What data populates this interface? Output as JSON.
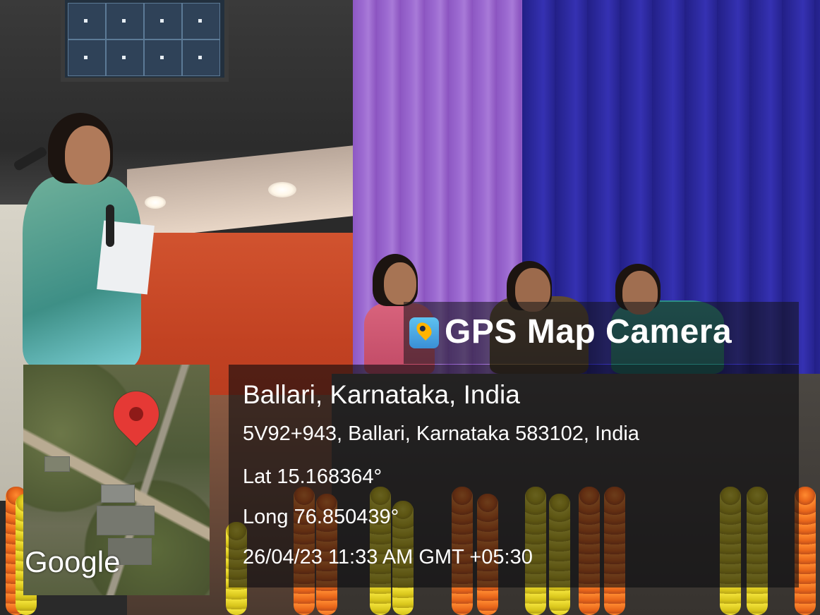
{
  "overlay": {
    "app_title": "GPS Map Camera",
    "place": "Ballari, Karnataka, India",
    "address": "5V92+943, Ballari, Karnataka 583102, India",
    "latitude": "Lat 15.168364°",
    "longitude": "Long 76.850439°",
    "timestamp": "26/04/23 11:33 AM GMT +05:30",
    "map_attribution": "Google",
    "map_pin_icon": "location-pin-icon",
    "app_logo_icon": "gps-map-camera-icon"
  },
  "colors": {
    "pin": "#e53935",
    "overlay_text": "#ffffff",
    "purple_curtain": "#9c6ad1",
    "blue_curtain": "#2d2aa0"
  }
}
